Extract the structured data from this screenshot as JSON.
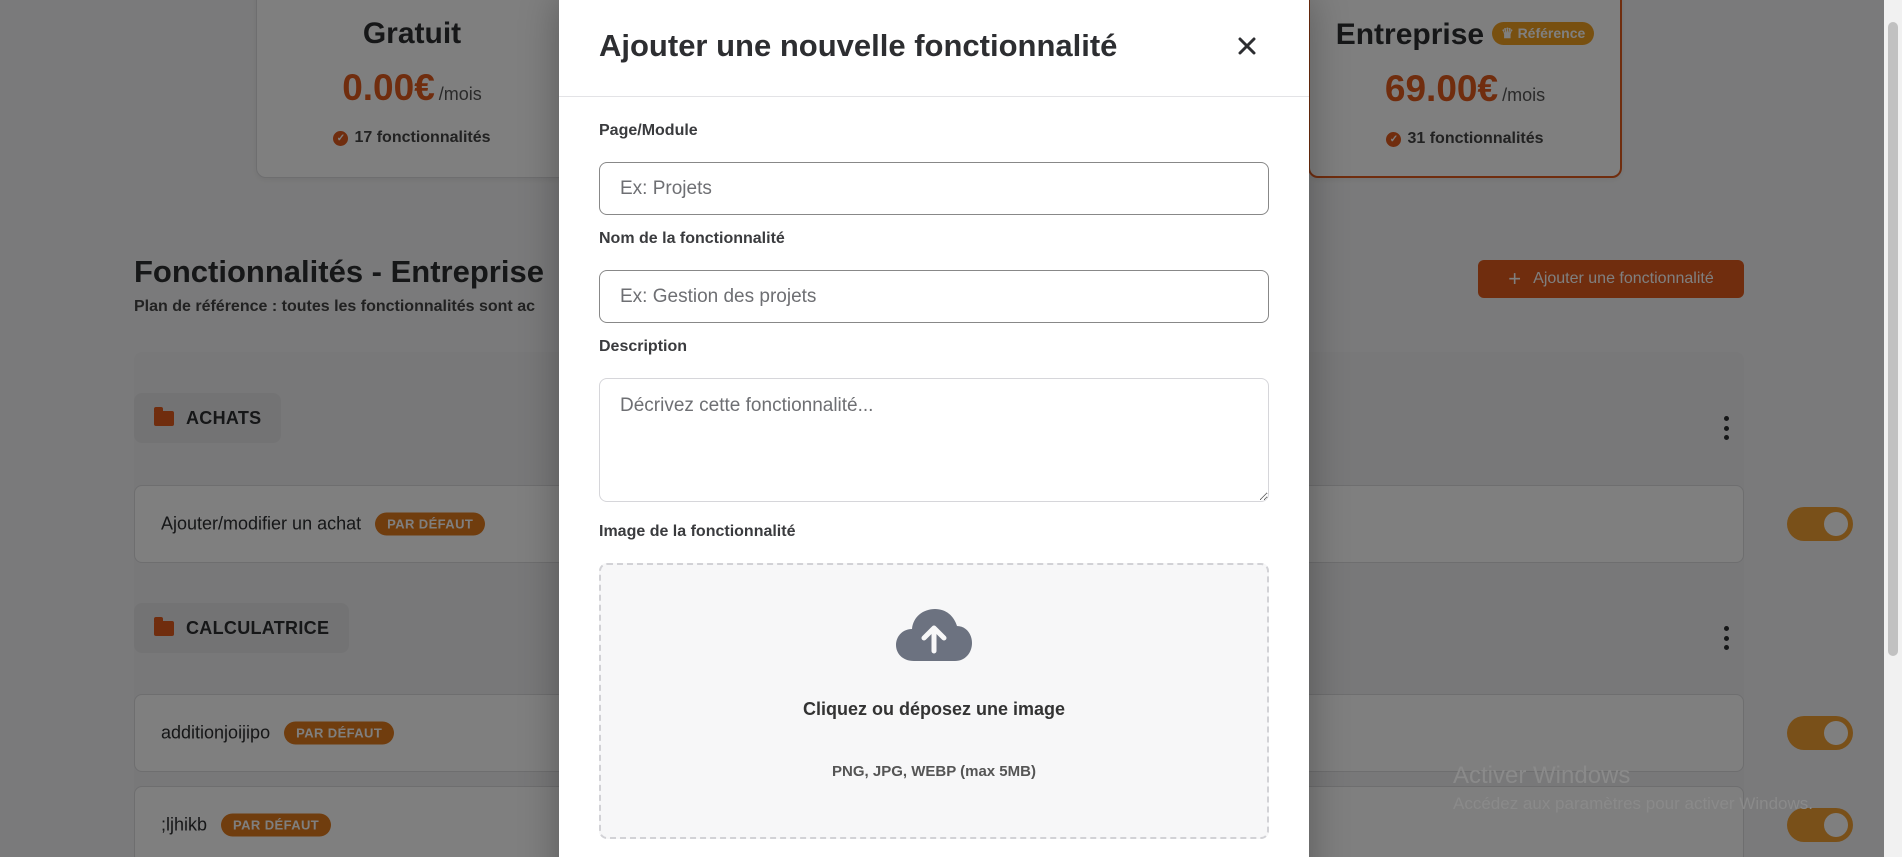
{
  "plans": [
    {
      "name": "Gratuit",
      "price": "0.00€",
      "period": "/mois",
      "features": "17 fonctionnalités",
      "badge": ""
    },
    {
      "name": "Entreprise",
      "price": "69.00€",
      "period": "/mois",
      "features": "31 fonctionnalités",
      "badge": "Référence"
    }
  ],
  "section": {
    "title": "Fonctionnalités - Entreprise",
    "subtitle": "Plan de référence : toutes les fonctionnalités sont ac",
    "add_button": "Ajouter une fonctionnalité"
  },
  "categories": [
    {
      "name": "ACHATS",
      "features": [
        {
          "name": "Ajouter/modifier un achat",
          "tag": "PAR DÉFAUT",
          "enabled": true
        }
      ]
    },
    {
      "name": "CALCULATRICE",
      "features": [
        {
          "name": "additionjoijipo",
          "tag": "PAR DÉFAUT",
          "enabled": true
        },
        {
          "name": ";ljhikb",
          "tag": "PAR DÉFAUT",
          "enabled": true
        }
      ]
    }
  ],
  "modal": {
    "title": "Ajouter une nouvelle fonctionnalité",
    "fields": {
      "page_label": "Page/Module",
      "page_placeholder": "Ex: Projets",
      "name_label": "Nom de la fonctionnalité",
      "name_placeholder": "Ex: Gestion des projets",
      "description_label": "Description",
      "description_placeholder": "Décrivez cette fonctionnalité...",
      "image_label": "Image de la fonctionnalité"
    },
    "dropzone": {
      "title": "Cliquez ou déposez une image",
      "hint": "PNG, JPG, WEBP (max 5MB)",
      "icon": "cloud-upload-icon"
    }
  },
  "windows_watermark": {
    "title": "Activer Windows",
    "subtitle": "Accédez aux paramètres pour activer Windows."
  },
  "colors": {
    "accent": "#e05a1d",
    "badge": "#f0a020",
    "toggle_on": "#f2a033"
  }
}
